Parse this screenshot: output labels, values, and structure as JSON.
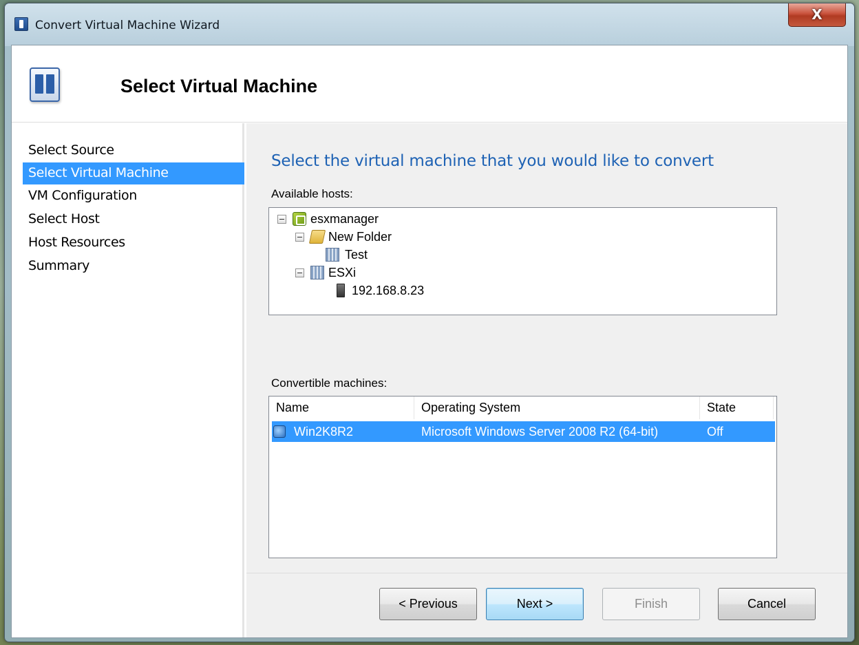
{
  "window": {
    "title": "Convert Virtual Machine Wizard",
    "close_label": "X"
  },
  "header": {
    "title": "Select Virtual Machine"
  },
  "sidebar": {
    "items": [
      {
        "label": "Select Source"
      },
      {
        "label": "Select Virtual Machine",
        "active": true
      },
      {
        "label": "VM Configuration"
      },
      {
        "label": "Select Host"
      },
      {
        "label": "Host Resources"
      },
      {
        "label": "Summary"
      }
    ]
  },
  "main": {
    "heading": "Select the virtual machine that you would like to convert",
    "hosts_label": "Available hosts:",
    "tree": [
      {
        "label": "esxmanager",
        "icon": "vcenter-icon",
        "expanded": true
      },
      {
        "label": "New Folder",
        "icon": "folder-icon",
        "expanded": true
      },
      {
        "label": "Test",
        "icon": "host-group-icon"
      },
      {
        "label": "ESXi",
        "icon": "host-group-icon",
        "expanded": true
      },
      {
        "label": "192.168.8.23",
        "icon": "server-icon"
      }
    ],
    "machines_label": "Convertible machines:",
    "columns": [
      "Name",
      "Operating System",
      "State"
    ],
    "rows": [
      {
        "name": "Win2K8R2",
        "os": "Microsoft Windows Server 2008 R2 (64-bit)",
        "state": "Off",
        "selected": true
      }
    ]
  },
  "footer": {
    "previous_label": "< Previous",
    "next_label": "Next >",
    "finish_label": "Finish",
    "cancel_label": "Cancel"
  },
  "colors": {
    "selection": "#3399ff",
    "heading": "#1e62b4",
    "panel_bg": "#f0f0f0"
  }
}
